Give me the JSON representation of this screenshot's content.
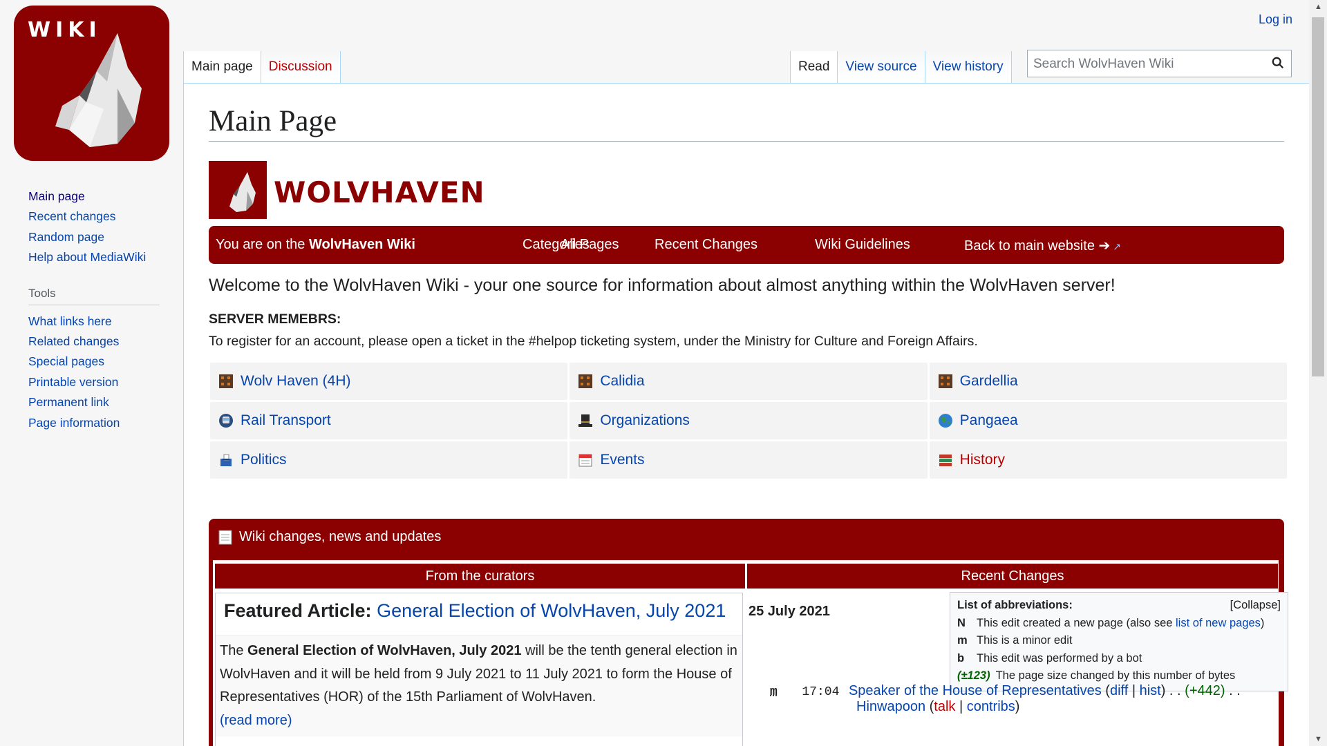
{
  "logo": {
    "text": "WIKI"
  },
  "sidebar": {
    "nav": [
      {
        "label": "Main page",
        "current": true
      },
      {
        "label": "Recent changes"
      },
      {
        "label": "Random page"
      },
      {
        "label": "Help about MediaWiki"
      }
    ],
    "tools_heading": "Tools",
    "tools": [
      {
        "label": "What links here"
      },
      {
        "label": "Related changes"
      },
      {
        "label": "Special pages"
      },
      {
        "label": "Printable version"
      },
      {
        "label": "Permanent link"
      },
      {
        "label": "Page information"
      }
    ]
  },
  "header": {
    "login": "Log in",
    "tabs_left": [
      "Main page",
      "Discussion"
    ],
    "tabs_right": [
      "Read",
      "View source",
      "View history"
    ],
    "search_placeholder": "Search WolvHaven Wiki"
  },
  "page": {
    "title": "Main Page",
    "brand": "WOLVHAVEN",
    "navbar": {
      "intro_prefix": "You are on the ",
      "intro_bold": "WolvHaven Wiki",
      "links": [
        "Categories",
        "All Pages",
        "Recent Changes",
        "Wiki Guidelines",
        "Back to main website ➔"
      ]
    },
    "welcome": "Welcome to the WolvHaven Wiki - your one source for information about almost anything within the WolvHaven server!",
    "members_heading": "SERVER MEMEBRS:",
    "register_text": "To register for an account, please open a ticket in the #helpop ticketing system, under the Ministry for Culture and Foreign Affairs.",
    "portals": [
      {
        "label": "Wolv Haven (4H)",
        "icon": "city-icon"
      },
      {
        "label": "Calidia",
        "icon": "city-icon"
      },
      {
        "label": "Gardellia",
        "icon": "city-icon"
      },
      {
        "label": "Rail Transport",
        "icon": "train-icon"
      },
      {
        "label": "Organizations",
        "icon": "hat-icon"
      },
      {
        "label": "Pangaea",
        "icon": "globe-icon"
      },
      {
        "label": "Politics",
        "icon": "ballot-box-icon"
      },
      {
        "label": "Events",
        "icon": "calendar-icon"
      },
      {
        "label": "History",
        "icon": "book-icon",
        "red": true
      }
    ]
  },
  "news": {
    "heading": "Wiki changes, news and updates",
    "curators_heading": "From the curators",
    "recent_heading": "Recent Changes",
    "featured_label": "Featured Article:",
    "featured_link": "General Election of WolvHaven, July 2021",
    "featured_body_prefix": "The ",
    "featured_body_bold": "General Election of WolvHaven, July 2021",
    "featured_body_rest": " will be the tenth general election in WolvHaven and it will be held from 9 July 2021 to 11 July 2021 to form the House of Representatives (HOR) of the 15th Parliament of WolvHaven.",
    "read_more": "(read more)",
    "rc_date": "25 July 2021",
    "abbr_title": "List of abbreviations:",
    "abbr_collapse": "[Collapse]",
    "abbr": [
      {
        "key": "N",
        "text": "This edit created a new page (also see ",
        "link": "list of new pages",
        "after": ")"
      },
      {
        "key": "m",
        "text": "This is a minor edit"
      },
      {
        "key": "b",
        "text": "This edit was performed by a bot"
      },
      {
        "key": "(±123)",
        "text": "The page size changed by this number of bytes"
      }
    ],
    "rc_entry": {
      "flag": "m",
      "time": "17:04",
      "page": "Speaker of the House of Representatives",
      "diff": "diff",
      "hist": "hist",
      "size": "(+442)",
      "user": "Hinwapoon",
      "talk": "talk",
      "contribs": "contribs"
    }
  }
}
